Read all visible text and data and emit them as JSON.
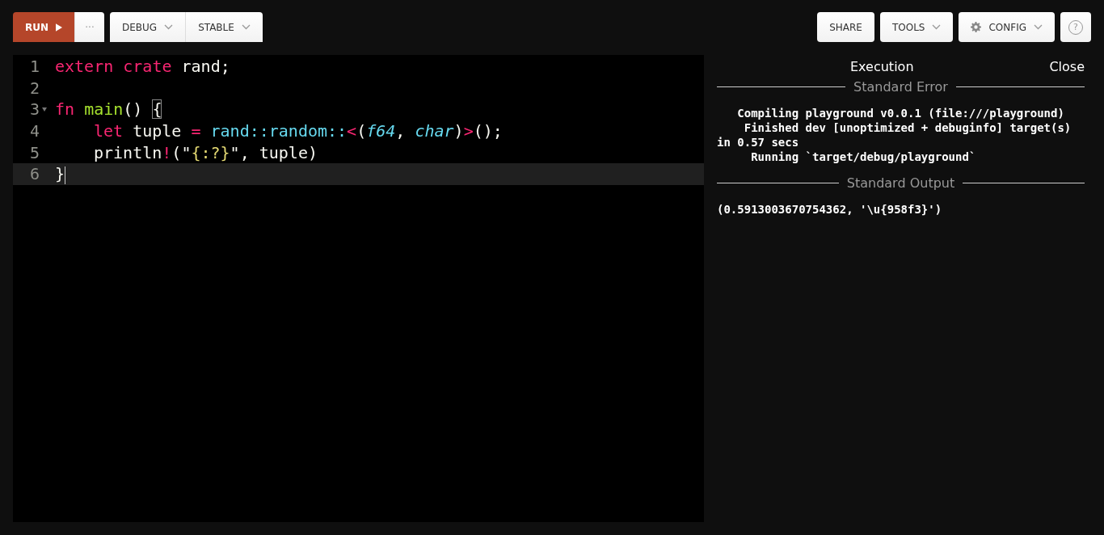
{
  "toolbar": {
    "left_groups": [
      [
        {
          "kind": "run",
          "label": "RUN"
        },
        {
          "kind": "more",
          "label": "···"
        }
      ],
      [
        {
          "kind": "dropdown",
          "label": "DEBUG"
        },
        {
          "kind": "dropdown",
          "label": "STABLE"
        }
      ]
    ],
    "right_buttons": [
      {
        "kind": "plain",
        "label": "SHARE"
      },
      {
        "kind": "dropdown",
        "label": "TOOLS"
      },
      {
        "kind": "config",
        "label": "CONFIG"
      },
      {
        "kind": "help",
        "label": "?"
      }
    ]
  },
  "editor": {
    "lines": [
      {
        "number": "1",
        "active": false,
        "foldable": false,
        "tokens": [
          {
            "kind": "keyword",
            "text": "extern crate"
          },
          {
            "kind": "plain",
            "text": " rand;"
          }
        ]
      },
      {
        "number": "2",
        "active": false,
        "foldable": false
      },
      {
        "number": "3",
        "active": false,
        "foldable": true,
        "tokens": [
          {
            "kind": "keyword",
            "text": "fn "
          },
          {
            "kind": "function",
            "text": "main"
          },
          {
            "kind": "plain",
            "text": "() "
          },
          {
            "kind": "bracket",
            "text": "{"
          }
        ],
        "children": [
          {
            "number": "4",
            "active": false,
            "foldable": false,
            "tokens": [
              {
                "kind": "keyword",
                "text": "let"
              },
              {
                "kind": "plain",
                "text": " tuple "
              },
              {
                "kind": "operator",
                "text": "= "
              },
              {
                "kind": "path",
                "text": "rand::random::"
              },
              {
                "kind": "operator",
                "text": "<"
              },
              {
                "kind": "plain",
                "text": "("
              },
              {
                "kind": "type",
                "text": "f64"
              },
              {
                "kind": "plain",
                "text": ", "
              },
              {
                "kind": "type",
                "text": "char"
              },
              {
                "kind": "plain",
                "text": ")"
              },
              {
                "kind": "operator",
                "text": ">"
              },
              {
                "kind": "plain",
                "text": "();"
              }
            ]
          },
          {
            "number": "5",
            "active": false,
            "foldable": false,
            "tokens": [
              {
                "kind": "plain",
                "text": "println"
              },
              {
                "kind": "operator",
                "text": "!"
              },
              {
                "kind": "plain",
                "text": "(\""
              },
              {
                "kind": "string",
                "text": "{:?}"
              },
              {
                "kind": "plain",
                "text": "\", tuple)"
              }
            ]
          }
        ]
      },
      {
        "number": "6",
        "active": true,
        "foldable": false,
        "tokens": [
          {
            "kind": "plain",
            "text": "}"
          }
        ]
      }
    ]
  },
  "output": {
    "title": "Execution",
    "close": "Close",
    "sections": [
      {
        "heading": "Standard Error",
        "text": "   Compiling playground v0.0.1 (file:///playground)\n    Finished dev [unoptimized + debuginfo] target(s)\nin 0.57 secs\n     Running `target/debug/playground`"
      },
      {
        "heading": "Standard Output",
        "text": "(0.5913003670754362, '\\u{958f3}')"
      }
    ]
  }
}
